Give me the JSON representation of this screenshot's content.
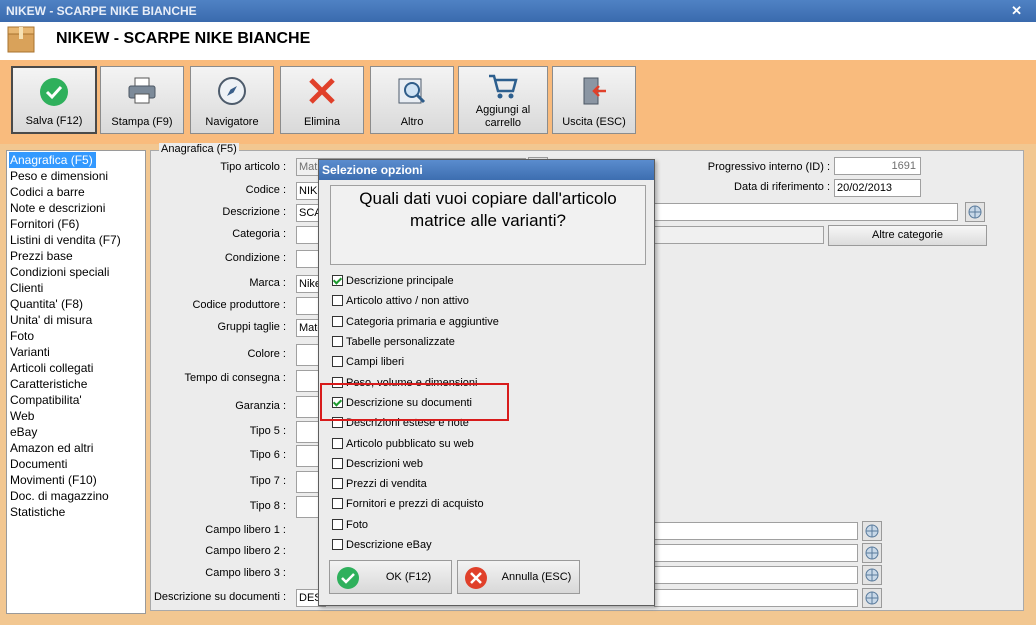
{
  "window": {
    "title": "NIKEW - SCARPE NIKE BIANCHE",
    "close_glyph": "✕"
  },
  "header": {
    "title": "NIKEW - SCARPE NIKE BIANCHE"
  },
  "toolbar": {
    "save": "Salva (F12)",
    "print": "Stampa (F9)",
    "navigator": "Navigatore",
    "delete": "Elimina",
    "other": "Altro",
    "add_cart_1": "Aggiungi al",
    "add_cart_2": "carrello",
    "exit": "Uscita (ESC)"
  },
  "sidebar": {
    "items": [
      "Anagrafica (F5)",
      "Peso e dimensioni",
      "Codici a barre",
      "Note e descrizioni",
      "Fornitori (F6)",
      "Listini di vendita (F7)",
      "Prezzi base",
      "Condizioni speciali",
      "Clienti",
      "Quantita' (F8)",
      "Unita' di misura",
      "Foto",
      "Varianti",
      "Articoli collegati",
      "Caratteristiche",
      "Compatibilita'",
      "Web",
      "eBay",
      "Amazon ed altri",
      "Documenti",
      "Movimenti (F10)",
      "Doc. di magazzino",
      "Statistiche"
    ],
    "selected": 0
  },
  "form": {
    "section_title": "Anagrafica (F5)",
    "labels": {
      "tipo": "Tipo articolo :",
      "codice": "Codice :",
      "descrizione": "Descrizione :",
      "categoria": "Categoria :",
      "condizione": "Condizione :",
      "marca": "Marca :",
      "codprod": "Codice produttore :",
      "gruppi": "Gruppi taglie :",
      "colore": "Colore :",
      "tempo": "Tempo di consegna :",
      "garanzia": "Garanzia :",
      "tipo5": "Tipo 5 :",
      "tipo6": "Tipo 6 :",
      "tipo7": "Tipo 7 :",
      "tipo8": "Tipo 8 :",
      "cl1": "Campo libero 1 :",
      "cl2": "Campo libero 2 :",
      "cl3": "Campo libero 3 :",
      "descdoc": "Descrizione su documenti :",
      "progressivo": "Progressivo interno (ID) :",
      "data_rif": "Data di riferimento :"
    },
    "values": {
      "tipo": "Mat",
      "codice": "NIKE",
      "descrizione": "SCA",
      "marca": "Nike",
      "gruppi": "Mate",
      "descdoc": "DES",
      "progressivo": "1691",
      "data_rif": "20/02/2013"
    },
    "altre_categorie": "Altre categorie"
  },
  "dialog": {
    "title": "Selezione opzioni",
    "question_1": "Quali dati vuoi copiare dall'articolo",
    "question_2": "matrice alle varianti?",
    "options": [
      {
        "label": "Descrizione principale",
        "checked": true
      },
      {
        "label": "Articolo attivo / non attivo",
        "checked": false
      },
      {
        "label": "Categoria primaria e aggiuntive",
        "checked": false
      },
      {
        "label": "Tabelle personalizzate",
        "checked": false
      },
      {
        "label": "Campi liberi",
        "checked": false
      },
      {
        "label": "Peso, volume e dimensioni",
        "checked": false
      },
      {
        "label": "Descrizione su documenti",
        "checked": true
      },
      {
        "label": "Descrizioni estese e note",
        "checked": false
      },
      {
        "label": "Articolo pubblicato su web",
        "checked": false
      },
      {
        "label": "Descrizioni web",
        "checked": false
      },
      {
        "label": "Prezzi di vendita",
        "checked": false
      },
      {
        "label": "Fornitori e prezzi di acquisto",
        "checked": false
      },
      {
        "label": "Foto",
        "checked": false
      },
      {
        "label": "Descrizione eBay",
        "checked": false
      }
    ],
    "ok": "OK (F12)",
    "cancel": "Annulla (ESC)"
  },
  "colors": {
    "accent_orange": "#f9bb7d",
    "highlight_red": "#d81b1b",
    "selection_blue": "#3399ff"
  }
}
